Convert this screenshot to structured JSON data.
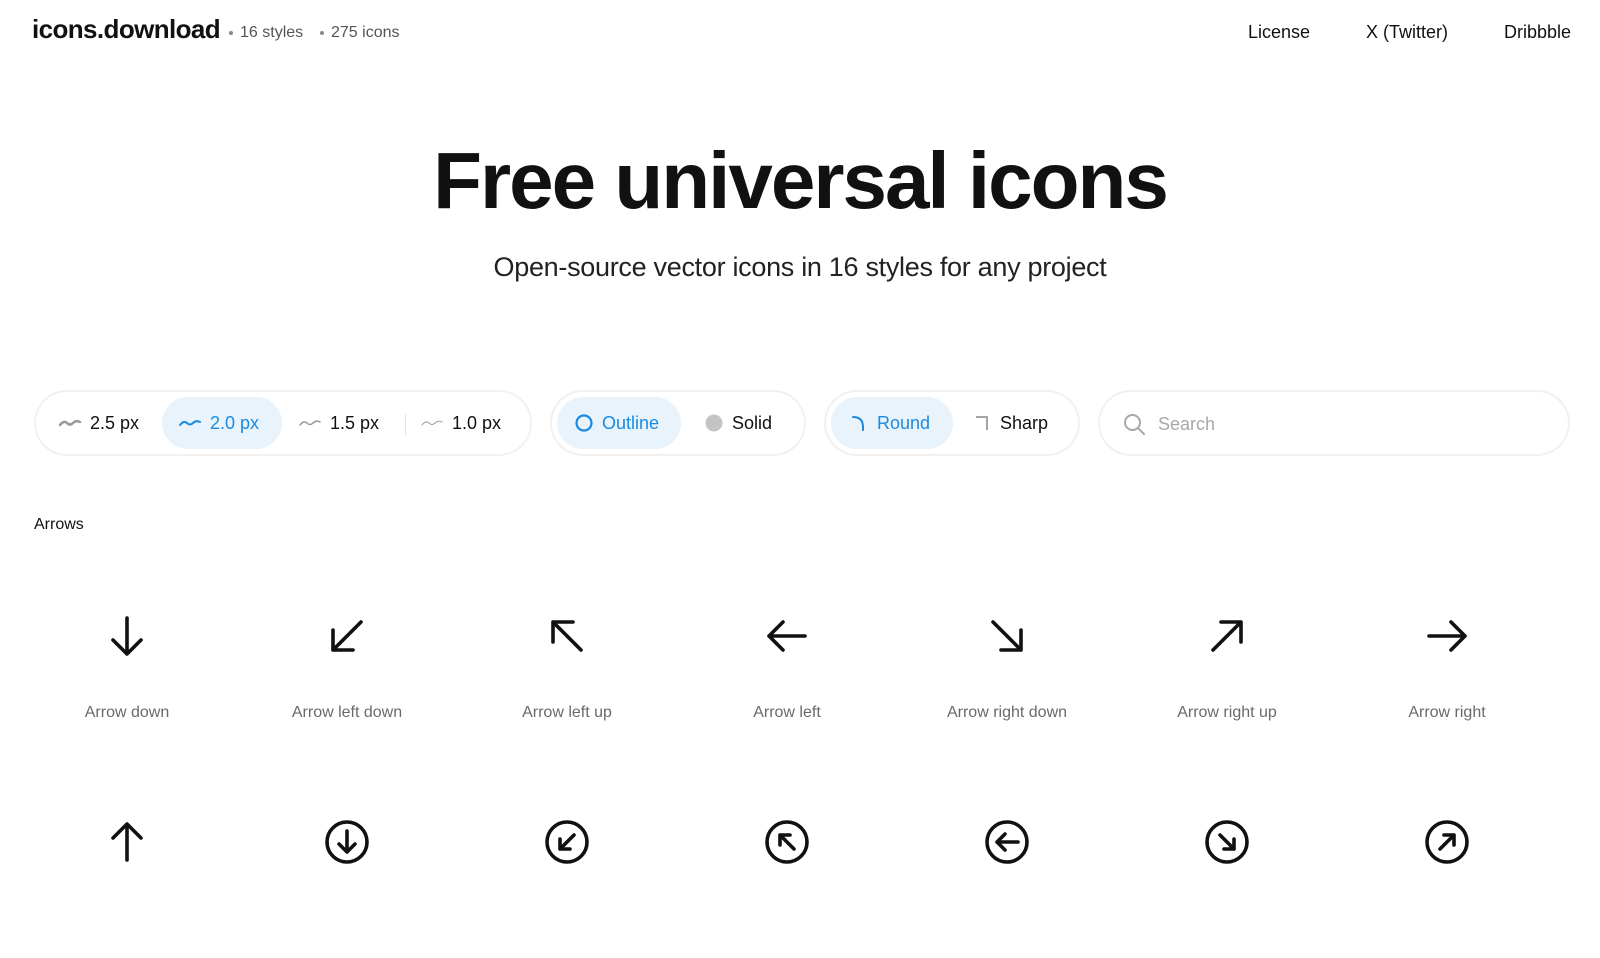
{
  "header": {
    "brand": "icons.download",
    "styles_count": "16 styles",
    "icons_count": "275 icons",
    "nav": {
      "license": "License",
      "twitter": "X (Twitter)",
      "dribbble": "Dribbble"
    }
  },
  "hero": {
    "title": "Free universal icons",
    "subtitle": "Open-source vector icons in 16 styles for any project"
  },
  "controls": {
    "weights": [
      {
        "label": "2.5 px",
        "selected": false
      },
      {
        "label": "2.0 px",
        "selected": true
      },
      {
        "label": "1.5 px",
        "selected": false
      },
      {
        "label": "1.0 px",
        "selected": false
      }
    ],
    "styles": [
      {
        "label": "Outline",
        "selected": true
      },
      {
        "label": "Solid",
        "selected": false
      }
    ],
    "corners": [
      {
        "label": "Round",
        "selected": true
      },
      {
        "label": "Sharp",
        "selected": false
      }
    ],
    "search": {
      "placeholder": "Search",
      "value": ""
    }
  },
  "colors": {
    "accent": "#1a8be0",
    "accent_bg": "#e8f3fc",
    "text": "#111111",
    "muted": "#6a6a6a"
  },
  "section": {
    "title": "Arrows",
    "icons": [
      {
        "name": "Arrow down",
        "icon": "arrow-down-icon"
      },
      {
        "name": "Arrow left down",
        "icon": "arrow-left-down-icon"
      },
      {
        "name": "Arrow left up",
        "icon": "arrow-left-up-icon"
      },
      {
        "name": "Arrow left",
        "icon": "arrow-left-icon"
      },
      {
        "name": "Arrow right down",
        "icon": "arrow-right-down-icon"
      },
      {
        "name": "Arrow right up",
        "icon": "arrow-right-up-icon"
      },
      {
        "name": "Arrow right",
        "icon": "arrow-right-icon"
      }
    ],
    "partial_row_icons": [
      "arrow-up-icon",
      "circle-arrow-down-icon",
      "circle-arrow-left-down-icon",
      "circle-arrow-left-up-icon",
      "circle-arrow-left-icon",
      "circle-arrow-right-down-icon",
      "circle-arrow-right-up-icon"
    ]
  }
}
